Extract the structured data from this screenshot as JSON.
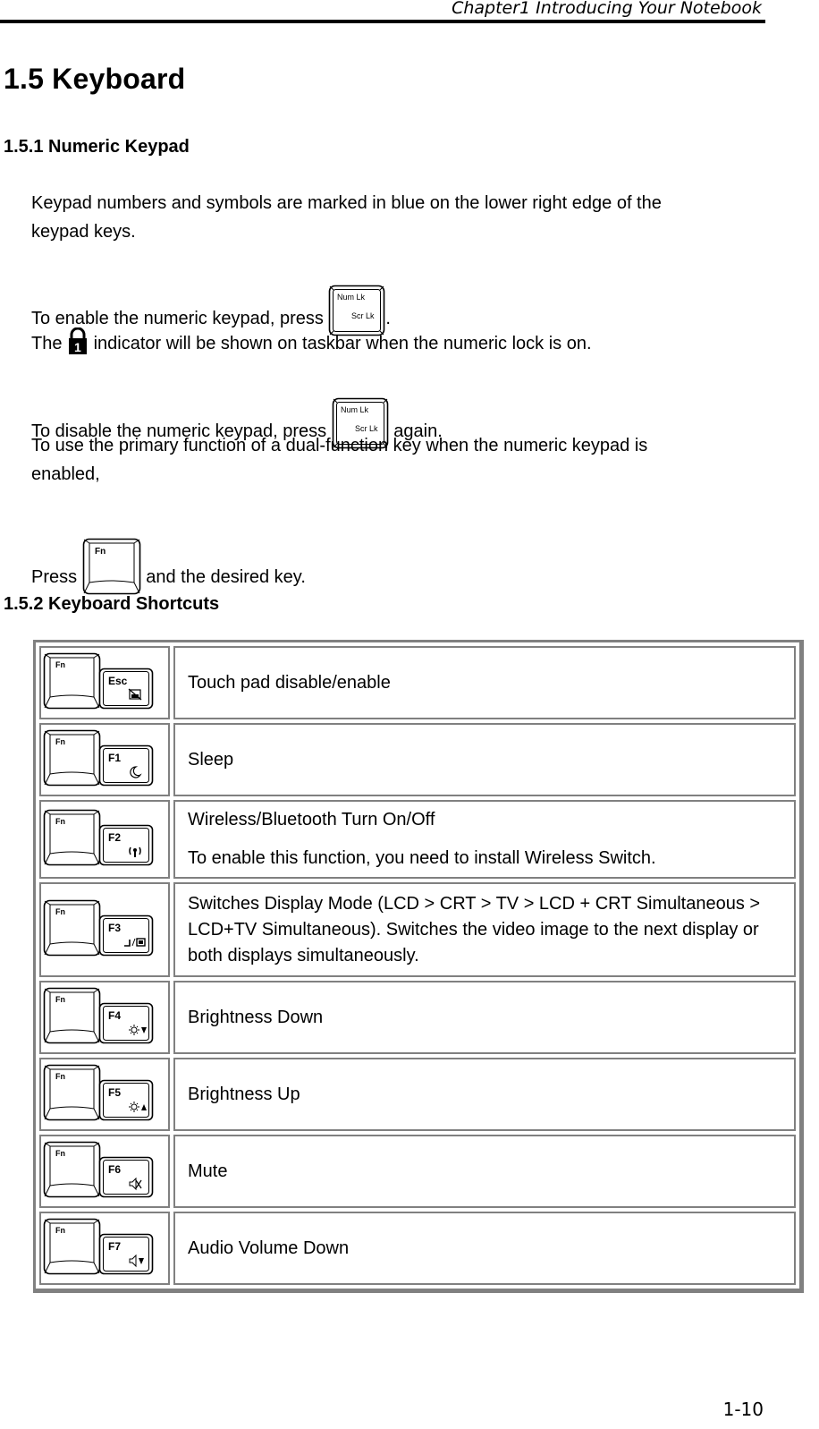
{
  "header": {
    "running_title": "Chapter1 Introducing Your Notebook"
  },
  "section": {
    "number_title": "1.5  Keyboard"
  },
  "numeric_keypad": {
    "heading": "1.5.1  Numeric Keypad",
    "intro_line1": "Keypad numbers and symbols are marked in blue on the lower right edge of the",
    "intro_line2": "keypad keys.",
    "enable_before": "To enable the numeric keypad, press ",
    "enable_after": ".",
    "indicator_before": "The ",
    "indicator_after": " indicator will be shown on taskbar when the numeric lock is on.",
    "disable_before": "To disable the numeric keypad, press ",
    "disable_after": " again.",
    "dual_line1": "To use the primary function of a dual-function key when the numeric keypad is",
    "dual_line2": "enabled,",
    "press_before": "Press ",
    "press_after": " and the desired key.",
    "numlock_key": {
      "top": "Num Lk",
      "bottom": "Scr Lk"
    },
    "fn_key": {
      "label": "Fn"
    },
    "indicator_icon": "numlock-padlock-1-icon"
  },
  "shortcuts": {
    "heading": "1.5.2  Keyboard Shortcuts",
    "rows": [
      {
        "modifier": "Fn",
        "key": "Esc",
        "icon": "touchpad-disable-icon",
        "desc": "Touch pad disable/enable",
        "desc2": null
      },
      {
        "modifier": "Fn",
        "key": "F1",
        "icon": "sleep-moon-icon",
        "desc": "Sleep",
        "desc2": null
      },
      {
        "modifier": "Fn",
        "key": "F2",
        "icon": "wireless-antenna-icon",
        "desc": "Wireless/Bluetooth Turn On/Off",
        "desc2": "To enable this function, you need to install Wireless Switch."
      },
      {
        "modifier": "Fn",
        "key": "F3",
        "icon": "display-switch-icon",
        "desc": "Switches Display Mode (LCD > CRT > TV > LCD + CRT Simultaneous > LCD+TV Simultaneous). Switches the video image to the next display or both displays simultaneously.",
        "desc2": null
      },
      {
        "modifier": "Fn",
        "key": "F4",
        "icon": "brightness-down-icon",
        "desc": "Brightness Down",
        "desc2": null
      },
      {
        "modifier": "Fn",
        "key": "F5",
        "icon": "brightness-up-icon",
        "desc": "Brightness Up",
        "desc2": null
      },
      {
        "modifier": "Fn",
        "key": "F6",
        "icon": "mute-icon",
        "desc": "Mute",
        "desc2": null
      },
      {
        "modifier": "Fn",
        "key": "F7",
        "icon": "volume-down-icon",
        "desc": "Audio Volume Down",
        "desc2": null
      }
    ]
  },
  "footer": {
    "page_number": "1-10"
  },
  "colors": {
    "table_border": "#808080",
    "text": "#000000",
    "rule": "#000000"
  }
}
